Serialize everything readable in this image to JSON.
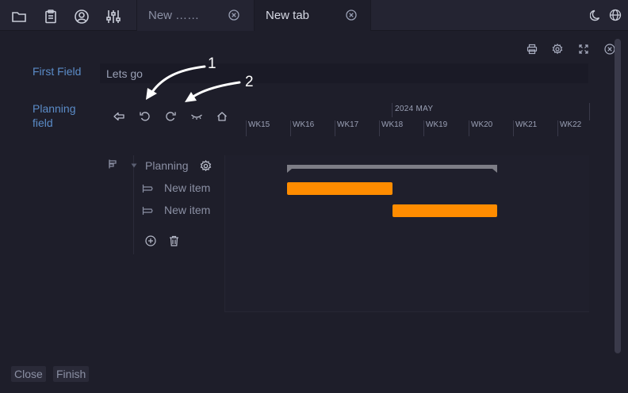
{
  "topbar": {
    "icons": [
      "folder-icon",
      "clipboard-icon",
      "user-circle-icon",
      "sliders-icon"
    ],
    "tabs": [
      {
        "label": "New ……",
        "active": false
      },
      {
        "label": "New tab",
        "active": true
      }
    ],
    "right_icons": [
      "moon-icon",
      "globe-icon"
    ]
  },
  "panel": {
    "actions": [
      "print-icon",
      "gear-icon",
      "fullscreen-icon",
      "close-icon"
    ]
  },
  "form": {
    "first_field": {
      "label": "First Field",
      "value": "Lets go"
    },
    "planning_field": {
      "label_line1": "Planning",
      "label_line2": "field"
    }
  },
  "toolbar": [
    "outdent-icon",
    "undo-icon",
    "redo-icon",
    "collapse-icon",
    "home-icon"
  ],
  "timeline": {
    "year_month": "2024  MAY",
    "weeks": [
      "WK15",
      "WK16",
      "WK17",
      "WK18",
      "WK19",
      "WK20",
      "WK21",
      "WK22"
    ]
  },
  "tree": {
    "root": {
      "label": "Planning"
    },
    "items": [
      {
        "label": "New item",
        "start_week": "WK16",
        "end_week": "WK18"
      },
      {
        "label": "New item",
        "start_week": "WK18",
        "end_week": "WK20"
      }
    ]
  },
  "footer": {
    "close_label": "Close",
    "finish_label": "Finish"
  },
  "annotations": [
    {
      "number": "1"
    },
    {
      "number": "2"
    }
  ],
  "colors": {
    "accent": "#ff8c00",
    "label": "#5b8cc8",
    "background": "#1e1e2a"
  }
}
